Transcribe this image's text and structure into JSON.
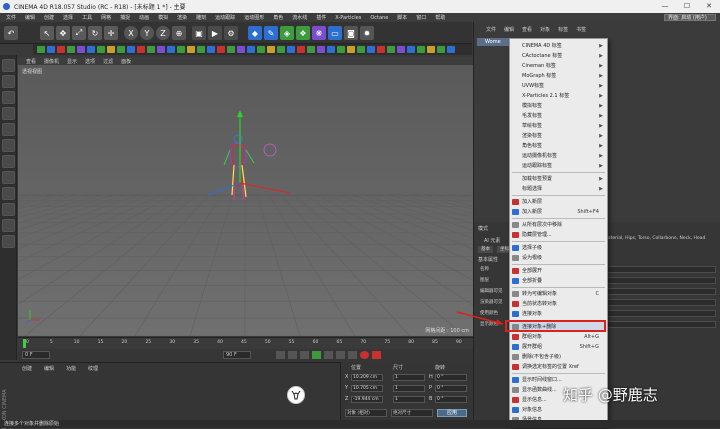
{
  "window": {
    "title": "CINEMA 4D R18.057 Studio (RC - R18) - [未标题 1 *] - 主要",
    "controls": [
      "—",
      "☐",
      "✕"
    ]
  },
  "menubar": {
    "items": [
      "文件",
      "编辑",
      "创建",
      "选择",
      "工具",
      "网格",
      "捕捉",
      "动画",
      "模拟",
      "渲染",
      "雕刻",
      "运动跟踪",
      "运动图形",
      "角色",
      "流水线",
      "插件",
      "X-Particles",
      "Octane",
      "脚本",
      "窗口",
      "帮助"
    ],
    "layout_label": "界面: 启动 (用户)"
  },
  "viewport": {
    "menu": [
      "查看",
      "摄像机",
      "显示",
      "选项",
      "过滤",
      "面板"
    ],
    "camera_label": "透视视图",
    "grid_label": "网格间距 : 100 cm"
  },
  "timeline": {
    "ticks": [
      "0",
      "5",
      "10",
      "15",
      "20",
      "25",
      "30",
      "35",
      "40",
      "45",
      "50",
      "55",
      "60",
      "65",
      "70",
      "75",
      "80",
      "85",
      "90"
    ],
    "frame_start": "0 F",
    "frame_end": "90 F",
    "current": "0 F"
  },
  "material_panel": {
    "menu": [
      "创建",
      "编辑",
      "功能",
      "纹理"
    ],
    "brand_line1": "MAXON",
    "brand_line2": "CINEMA 4D"
  },
  "coordinates": {
    "headers": [
      "位置",
      "尺寸",
      "旋转"
    ],
    "rows": [
      {
        "axis": "X",
        "pos": "10.209 cm",
        "size": "1",
        "rot_axis": "H",
        "rot": "0 °"
      },
      {
        "axis": "Y",
        "pos": "10.705 cm",
        "size": "1",
        "rot_axis": "P",
        "rot": "0 °"
      },
      {
        "axis": "Z",
        "pos": "-19.944 cm",
        "size": "1",
        "rot_axis": "B",
        "rot": "0 °"
      }
    ],
    "mode": "对象 (相对)",
    "size_mode": "绝对尺寸",
    "apply": "应用"
  },
  "object_manager": {
    "menu": [
      "文件",
      "编辑",
      "查看",
      "对象",
      "标签",
      "书签"
    ],
    "object_name": "Wome"
  },
  "attribute_manager": {
    "mode_label": "模式",
    "object_label": "Al 元素",
    "tabs": [
      "基本",
      "坐标"
    ],
    "materials": "Material, Hips, Torso, Collarbone, Neck, Head",
    "section": "基本属性",
    "rows": [
      "名称",
      "图层",
      "编辑器可见",
      "渲染器可见",
      "使用颜色",
      "显示颜色"
    ]
  },
  "context_menu": {
    "items": [
      {
        "label": "CINEMA 4D 标签",
        "arrow": true
      },
      {
        "label": "CActoctane 标签",
        "arrow": true
      },
      {
        "label": "Cineman 标签",
        "arrow": true
      },
      {
        "label": "MoGraph 标签",
        "arrow": true
      },
      {
        "label": "UVW标签",
        "arrow": true
      },
      {
        "label": "X-Particles 2.1 标签",
        "arrow": true
      },
      {
        "label": "模拟标签",
        "arrow": true
      },
      {
        "label": "毛发标签",
        "arrow": true
      },
      {
        "label": "草绘标签",
        "arrow": true
      },
      {
        "label": "渲染标签",
        "arrow": true
      },
      {
        "label": "角色标签",
        "arrow": true
      },
      {
        "label": "运动摄像机标签",
        "arrow": true
      },
      {
        "label": "运动跟踪标签",
        "arrow": true
      },
      {
        "label": "加载标签预置",
        "arrow": true
      },
      {
        "label": "标题选择",
        "arrow": true
      },
      {
        "label": "加入新层",
        "shortcut": ""
      },
      {
        "label": "加入新层",
        "shortcut": "Shift+F4"
      },
      {
        "label": "从所有层次中移除",
        "shortcut": ""
      },
      {
        "label": "隐藏层管理...",
        "shortcut": ""
      },
      {
        "label": "选择子级",
        "shortcut": ""
      },
      {
        "label": "设为根级",
        "shortcut": ""
      },
      {
        "label": "全部展开",
        "shortcut": ""
      },
      {
        "label": "全部折叠",
        "shortcut": ""
      },
      {
        "label": "转为可编辑对象",
        "shortcut": "C"
      },
      {
        "label": "当前状态转对象",
        "shortcut": ""
      },
      {
        "label": "连接对象",
        "shortcut": ""
      },
      {
        "label": "连接对象+删除",
        "shortcut": "",
        "highlight": true
      },
      {
        "label": "群组对象",
        "shortcut": "Alt+G"
      },
      {
        "label": "展开群组",
        "shortcut": "Shift+G"
      },
      {
        "label": "删除(不包含子级)",
        "shortcut": ""
      },
      {
        "label": "调换选定标签的位置 Xref",
        "shortcut": ""
      },
      {
        "label": "显示时间线窗口...",
        "shortcut": ""
      },
      {
        "label": "显示函数曲线...",
        "shortcut": ""
      },
      {
        "label": "显示信息...",
        "shortcut": ""
      },
      {
        "label": "对象信息",
        "shortcut": ""
      },
      {
        "label": "场景信息",
        "shortcut": ""
      }
    ]
  },
  "status": "连接多个对象并删除原始",
  "watermark": "知乎 @野鹿志"
}
